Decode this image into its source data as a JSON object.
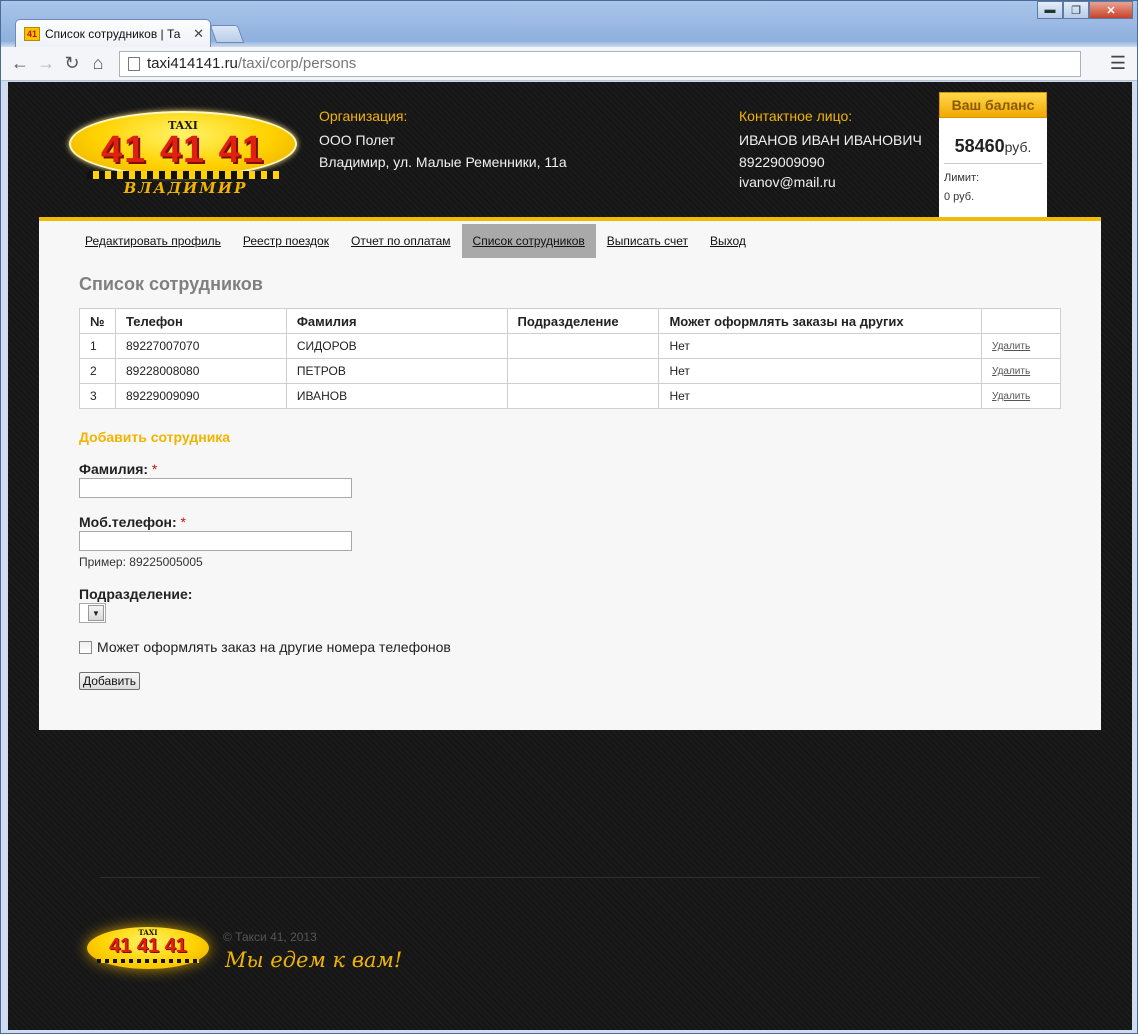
{
  "browser": {
    "tab_title": "Список сотрудников | Та",
    "tab_favicon_text": "41",
    "url_host": "taxi414141.ru",
    "url_path": "/taxi/corp/persons",
    "win_minimize": "▬",
    "win_maximize": "❐",
    "win_close": "✕"
  },
  "header": {
    "logo_taxi": "TAXI",
    "logo_number": "41 41 41",
    "logo_city": "ВЛАДИМИР",
    "org_label": "Организация:",
    "org_name": "ООО Полет",
    "org_address": "Владимир, ул. Малые Ременники, 11а",
    "contact_label": "Контактное лицо:",
    "contact_name": "ИВАНОВ ИВАН ИВАНОВИЧ",
    "contact_phone": "89229009090",
    "contact_email": "ivanov@mail.ru"
  },
  "balance": {
    "title": "Ваш баланс",
    "amount": "58460",
    "currency": "руб.",
    "limit_label": "Лимит:",
    "limit_value": "0 руб."
  },
  "menu": {
    "items": [
      {
        "label": "Редактировать профиль"
      },
      {
        "label": "Реестр поездок"
      },
      {
        "label": "Отчет по оплатам"
      },
      {
        "label": "Список сотрудников"
      },
      {
        "label": "Выписать счет"
      },
      {
        "label": "Выход"
      }
    ],
    "active_index": 3
  },
  "main": {
    "title": "Список сотрудников",
    "table": {
      "headers": [
        "№",
        "Телефон",
        "Фамилия",
        "Подразделение",
        "Может оформлять заказы на других",
        ""
      ],
      "rows": [
        {
          "num": "1",
          "phone": "89227007070",
          "surname": "СИДОРОВ",
          "department": "",
          "can_order": "Нет",
          "action": "Удалить"
        },
        {
          "num": "2",
          "phone": "89228008080",
          "surname": "ПЕТРОВ",
          "department": "",
          "can_order": "Нет",
          "action": "Удалить"
        },
        {
          "num": "3",
          "phone": "89229009090",
          "surname": "ИВАНОВ",
          "department": "",
          "can_order": "Нет",
          "action": "Удалить"
        }
      ]
    }
  },
  "form": {
    "title": "Добавить сотрудника",
    "surname_label": "Фамилия:",
    "required_mark": "*",
    "phone_label": "Моб.телефон:",
    "phone_hint": "Пример: 89225005005",
    "department_label": "Подразделение:",
    "department_selected": "",
    "checkbox_label": "Может оформлять заказ на другие номера телефонов",
    "submit_label": "Добавить"
  },
  "footer": {
    "logo_taxi": "TAXI",
    "logo_number": "41 41 41",
    "copyright": "© Такси 41, 2013",
    "slogan": "Мы едем к вам!"
  },
  "colors": {
    "accent": "#f0bb00",
    "page_bg": "#151515",
    "content_bg": "#f7f7f7",
    "active_menu": "#a9a9a9"
  }
}
